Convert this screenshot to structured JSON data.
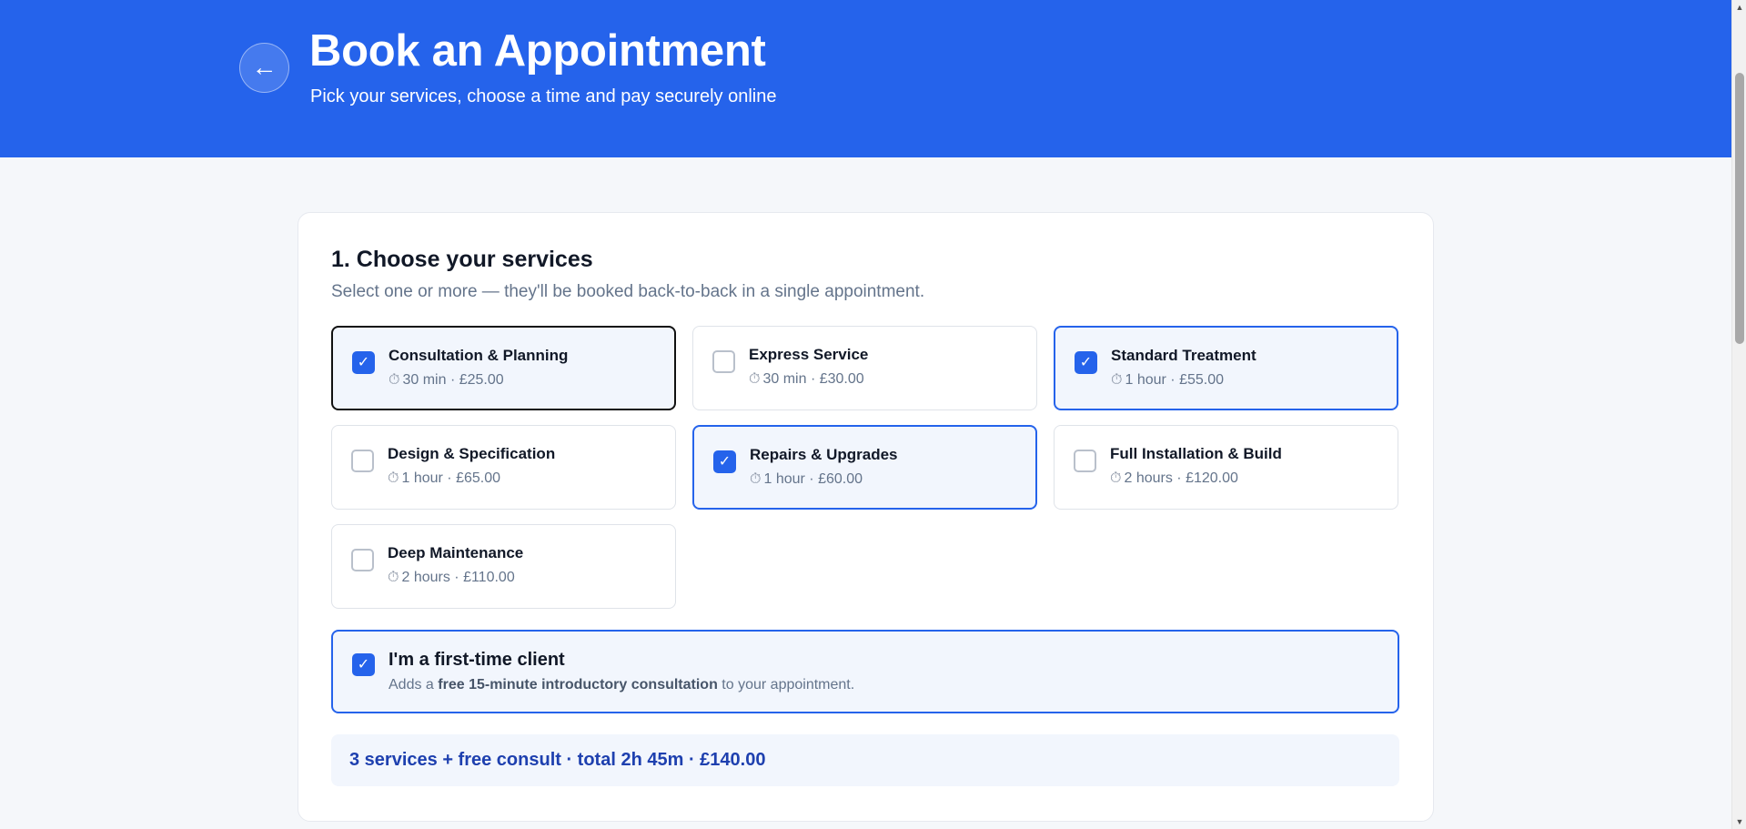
{
  "header": {
    "back_label": "←",
    "title": "Book an Appointment",
    "subtitle": "Pick your services, choose a time and pay securely online"
  },
  "services_section": {
    "title": "1. Choose your services",
    "description": "Select one or more — they'll be booked back-to-back in a single appointment.",
    "items": [
      {
        "name": "Consultation & Planning",
        "meta": "30 min · £25.00",
        "selected": true
      },
      {
        "name": "Express Service",
        "meta": "30 min · £30.00",
        "selected": false
      },
      {
        "name": "Standard Treatment",
        "meta": "1 hour · £55.00",
        "selected": true
      },
      {
        "name": "Design & Specification",
        "meta": "1 hour · £65.00",
        "selected": false
      },
      {
        "name": "Repairs & Upgrades",
        "meta": "1 hour · £60.00",
        "selected": true
      },
      {
        "name": "Full Installation & Build",
        "meta": "2 hours · £120.00",
        "selected": false
      },
      {
        "name": "Deep Maintenance",
        "meta": "2 hours · £110.00",
        "selected": false
      }
    ],
    "check_glyph": "✓",
    "clock_glyph": "⏱"
  },
  "first_time": {
    "checked": true,
    "title": "I'm a first-time client",
    "desc_prefix": "Adds a ",
    "desc_bold": "free 15-minute introductory consultation",
    "desc_suffix": " to your appointment."
  },
  "summary": {
    "text": "3 services + free consult · total 2h 45m · £140.00"
  },
  "colors": {
    "brand": "#2563eb",
    "selected_bg": "#f2f6fd",
    "summary_text": "#1e40af"
  }
}
